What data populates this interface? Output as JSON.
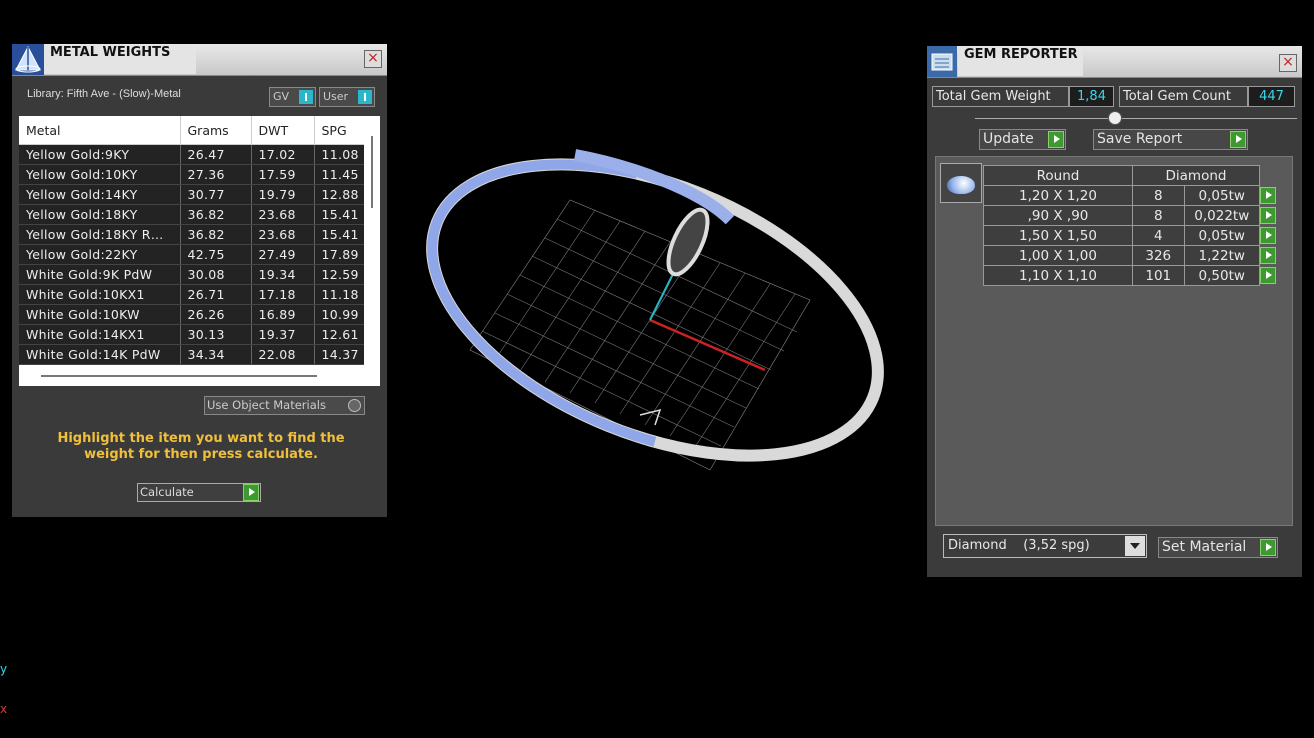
{
  "metal_weights": {
    "title": "METAL WEIGHTS",
    "library_label": "Library: Fifth Ave - (Slow)-Metal",
    "toggle_gv": "GV",
    "toggle_user": "User",
    "columns": [
      "Metal",
      "Grams",
      "DWT",
      "SPG"
    ],
    "rows": [
      {
        "metal": "Yellow Gold:9KY",
        "grams": "26.47",
        "dwt": "17.02",
        "spg": "11.08"
      },
      {
        "metal": "Yellow Gold:10KY",
        "grams": "27.36",
        "dwt": "17.59",
        "spg": "11.45"
      },
      {
        "metal": "Yellow Gold:14KY",
        "grams": "30.77",
        "dwt": "19.79",
        "spg": "12.88"
      },
      {
        "metal": "Yellow Gold:18KY",
        "grams": "36.82",
        "dwt": "23.68",
        "spg": "15.41"
      },
      {
        "metal": "Yellow Gold:18KY R…",
        "grams": "36.82",
        "dwt": "23.68",
        "spg": "15.41"
      },
      {
        "metal": "Yellow Gold:22KY",
        "grams": "42.75",
        "dwt": "27.49",
        "spg": "17.89"
      },
      {
        "metal": "White Gold:9K PdW",
        "grams": "30.08",
        "dwt": "19.34",
        "spg": "12.59"
      },
      {
        "metal": "White Gold:10KX1",
        "grams": "26.71",
        "dwt": "17.18",
        "spg": "11.18"
      },
      {
        "metal": "White Gold:10KW",
        "grams": "26.26",
        "dwt": "16.89",
        "spg": "10.99"
      },
      {
        "metal": "White Gold:14KX1",
        "grams": "30.13",
        "dwt": "19.37",
        "spg": "12.61"
      },
      {
        "metal": "White Gold:14K PdW",
        "grams": "34.34",
        "dwt": "22.08",
        "spg": "14.37"
      }
    ],
    "use_object_materials": "Use Object Materials",
    "hint": "Highlight the item you want to find the weight for then press calculate.",
    "calculate_label": "Calculate"
  },
  "gem_reporter": {
    "title": "GEM REPORTER",
    "total_weight_label": "Total Gem Weight",
    "total_weight_value": "1,84",
    "total_count_label": "Total Gem Count",
    "total_count_value": "447",
    "update_label": "Update",
    "save_report_label": "Save Report",
    "shape_header": "Round",
    "material_header": "Diamond",
    "gems": [
      {
        "size": "1,20 X 1,20",
        "count": "8",
        "weight": "0,05tw"
      },
      {
        "size": ",90 X ,90",
        "count": "8",
        "weight": "0,022tw"
      },
      {
        "size": "1,50 X 1,50",
        "count": "4",
        "weight": "0,05tw"
      },
      {
        "size": "1,00 X 1,00",
        "count": "326",
        "weight": "1,22tw"
      },
      {
        "size": "1,10 X 1,10",
        "count": "101",
        "weight": "0,50tw"
      }
    ],
    "material_select": "Diamond    (3,52 spg)",
    "set_material_label": "Set Material"
  },
  "viewport": {
    "axis_y": "y",
    "axis_x": "x"
  },
  "colors": {
    "accent_cyan": "#3bd5e8",
    "hint_yellow": "#f0c03a",
    "play_green": "#3c9a2f"
  }
}
